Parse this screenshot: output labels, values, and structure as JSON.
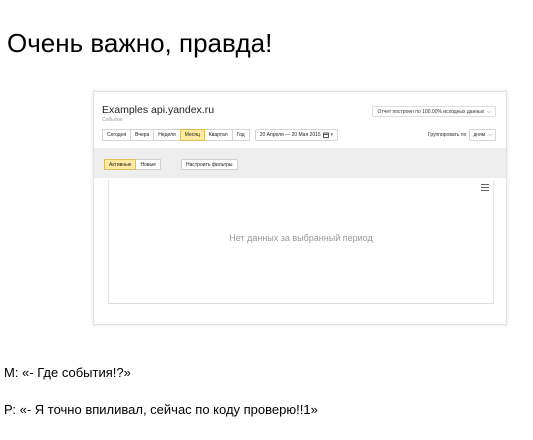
{
  "slide": {
    "title": "Очень важно, правда!"
  },
  "app": {
    "title": "Examples api.yandex.ru",
    "subtitle": "События",
    "report_note": "Отчет построен по 100.00% исходных данных"
  },
  "toolbar": {
    "periods": [
      {
        "label": "Сегодня",
        "active": false
      },
      {
        "label": "Вчера",
        "active": false
      },
      {
        "label": "Неделя",
        "active": false
      },
      {
        "label": "Месяц",
        "active": true
      },
      {
        "label": "Квартал",
        "active": false
      },
      {
        "label": "Год",
        "active": false
      }
    ],
    "date_range": "20 Апреля — 20 Мая 2015",
    "group_by_label": "Группировать по",
    "group_by_value": "дням"
  },
  "filters": {
    "tabs": [
      {
        "label": "Активные",
        "active": true
      },
      {
        "label": "Новые",
        "active": false
      }
    ],
    "configure_label": "Настроить фильтры"
  },
  "table": {
    "empty_message": "Нет данных за выбранный период"
  },
  "dialog": {
    "line_m": "М: «- Где события!?»",
    "line_p": "Р: «- Я точно впиливал, сейчас по коду проверю!!1»"
  }
}
